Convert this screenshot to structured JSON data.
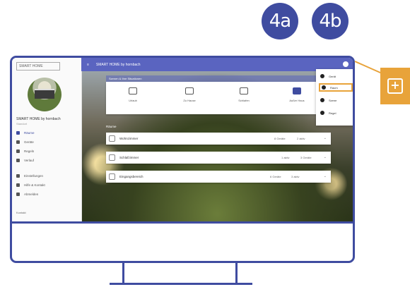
{
  "steps": {
    "a": "4a",
    "b": "4b"
  },
  "app": {
    "logo": "SMART HOME",
    "header_title": "SMART HOME by hornbach",
    "user_name": "SMART HOME by hornbach",
    "user_sub": "Standort"
  },
  "sidebar": {
    "items": [
      {
        "label": "Räume",
        "active": true
      },
      {
        "label": "Geräte"
      },
      {
        "label": "Regeln"
      },
      {
        "label": "Verlauf"
      },
      {
        "label": "Einstellungen"
      },
      {
        "label": "Hilfe & Kontakt"
      },
      {
        "label": "Abmelden"
      }
    ],
    "footer": "Kontakt"
  },
  "scenes": {
    "title": "Szenen & Ihre Situationen",
    "items": [
      "Urlaub",
      "Zu Hause",
      "Schlafen",
      "Außer Haus"
    ]
  },
  "rooms": {
    "title": "Räume",
    "items": [
      {
        "name": "Wohnzimmer",
        "stat1": "8 Geräte",
        "stat2": "2 aktiv"
      },
      {
        "name": "Schlafzimmer",
        "stat1": "1 aktiv",
        "stat2": "3 Geräte"
      },
      {
        "name": "Eingangsbereich",
        "stat1": "6 Geräte",
        "stat2": "3 aktiv"
      }
    ]
  },
  "menu": {
    "items": [
      "Gerät",
      "Raum",
      "Szene",
      "Regel"
    ]
  },
  "colors": {
    "brand": "#3f4ca0",
    "accent": "#e8a33a"
  }
}
